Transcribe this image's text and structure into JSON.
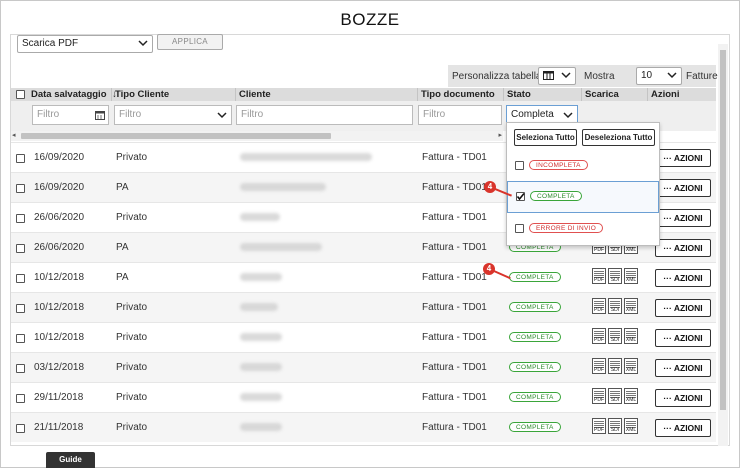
{
  "page": {
    "title": "BOZZE"
  },
  "toolbar": {
    "export_select": "Scarica PDF",
    "apply_label": "APPLICA",
    "customize_label": "Personalizza tabella",
    "show_label": "Mostra",
    "page_size": "10",
    "page_size_unit": "Fatture"
  },
  "columns": {
    "date": "Data salvataggio",
    "client_type": "Tipo Cliente",
    "client": "Cliente",
    "doc_type": "Tipo documento",
    "status": "Stato",
    "download": "Scarica",
    "actions": "Azioni"
  },
  "filters": {
    "date_placeholder": "Filtro",
    "client_type_placeholder": "Filtro",
    "client_placeholder": "Filtro",
    "doc_type_placeholder": "Filtro",
    "status_value": "Completa"
  },
  "status_dropdown": {
    "select_all": "Seleziona Tutto",
    "deselect_all": "Deseleziona Tutto",
    "options": [
      {
        "label": "INCOMPLETA",
        "checked": false,
        "color": "#d03030"
      },
      {
        "label": "COMPLETA",
        "checked": true,
        "color": "#2a8a2a"
      },
      {
        "label": "ERRORE DI INVIO",
        "checked": false,
        "color": "#d03030"
      }
    ]
  },
  "rows": [
    {
      "date": "16/09/2020",
      "client_type": "Privato",
      "doc_type": "Fattura - TD01",
      "status": "",
      "action": "AZIONI"
    },
    {
      "date": "16/09/2020",
      "client_type": "PA",
      "doc_type": "Fattura - TD01",
      "status": "",
      "action": "AZIONI"
    },
    {
      "date": "26/06/2020",
      "client_type": "Privato",
      "doc_type": "Fattura - TD01",
      "status": "",
      "action": "AZIONI"
    },
    {
      "date": "26/06/2020",
      "client_type": "PA",
      "doc_type": "Fattura - TD01",
      "status": "COMPLETA",
      "action": "AZIONI"
    },
    {
      "date": "10/12/2018",
      "client_type": "PA",
      "doc_type": "Fattura - TD01",
      "status": "COMPLETA",
      "action": "AZIONI"
    },
    {
      "date": "10/12/2018",
      "client_type": "Privato",
      "doc_type": "Fattura - TD01",
      "status": "COMPLETA",
      "action": "AZIONI"
    },
    {
      "date": "10/12/2018",
      "client_type": "Privato",
      "doc_type": "Fattura - TD01",
      "status": "COMPLETA",
      "action": "AZIONI"
    },
    {
      "date": "03/12/2018",
      "client_type": "Privato",
      "doc_type": "Fattura - TD01",
      "status": "COMPLETA",
      "action": "AZIONI"
    },
    {
      "date": "29/11/2018",
      "client_type": "Privato",
      "doc_type": "Fattura - TD01",
      "status": "COMPLETA",
      "action": "AZIONI"
    },
    {
      "date": "21/11/2018",
      "client_type": "Privato",
      "doc_type": "Fattura - TD01",
      "status": "COMPLETA",
      "action": "AZIONI"
    }
  ],
  "download_icons": {
    "pdf": "PDF",
    "sdi": "SDI",
    "xml": "XML"
  },
  "callouts": {
    "step": "4"
  },
  "footer": {
    "guide_label": "Guide"
  },
  "colors": {
    "accent_red": "#d9342b",
    "ok_green": "#2a8a2a",
    "header_gray": "#dcdcdc"
  }
}
